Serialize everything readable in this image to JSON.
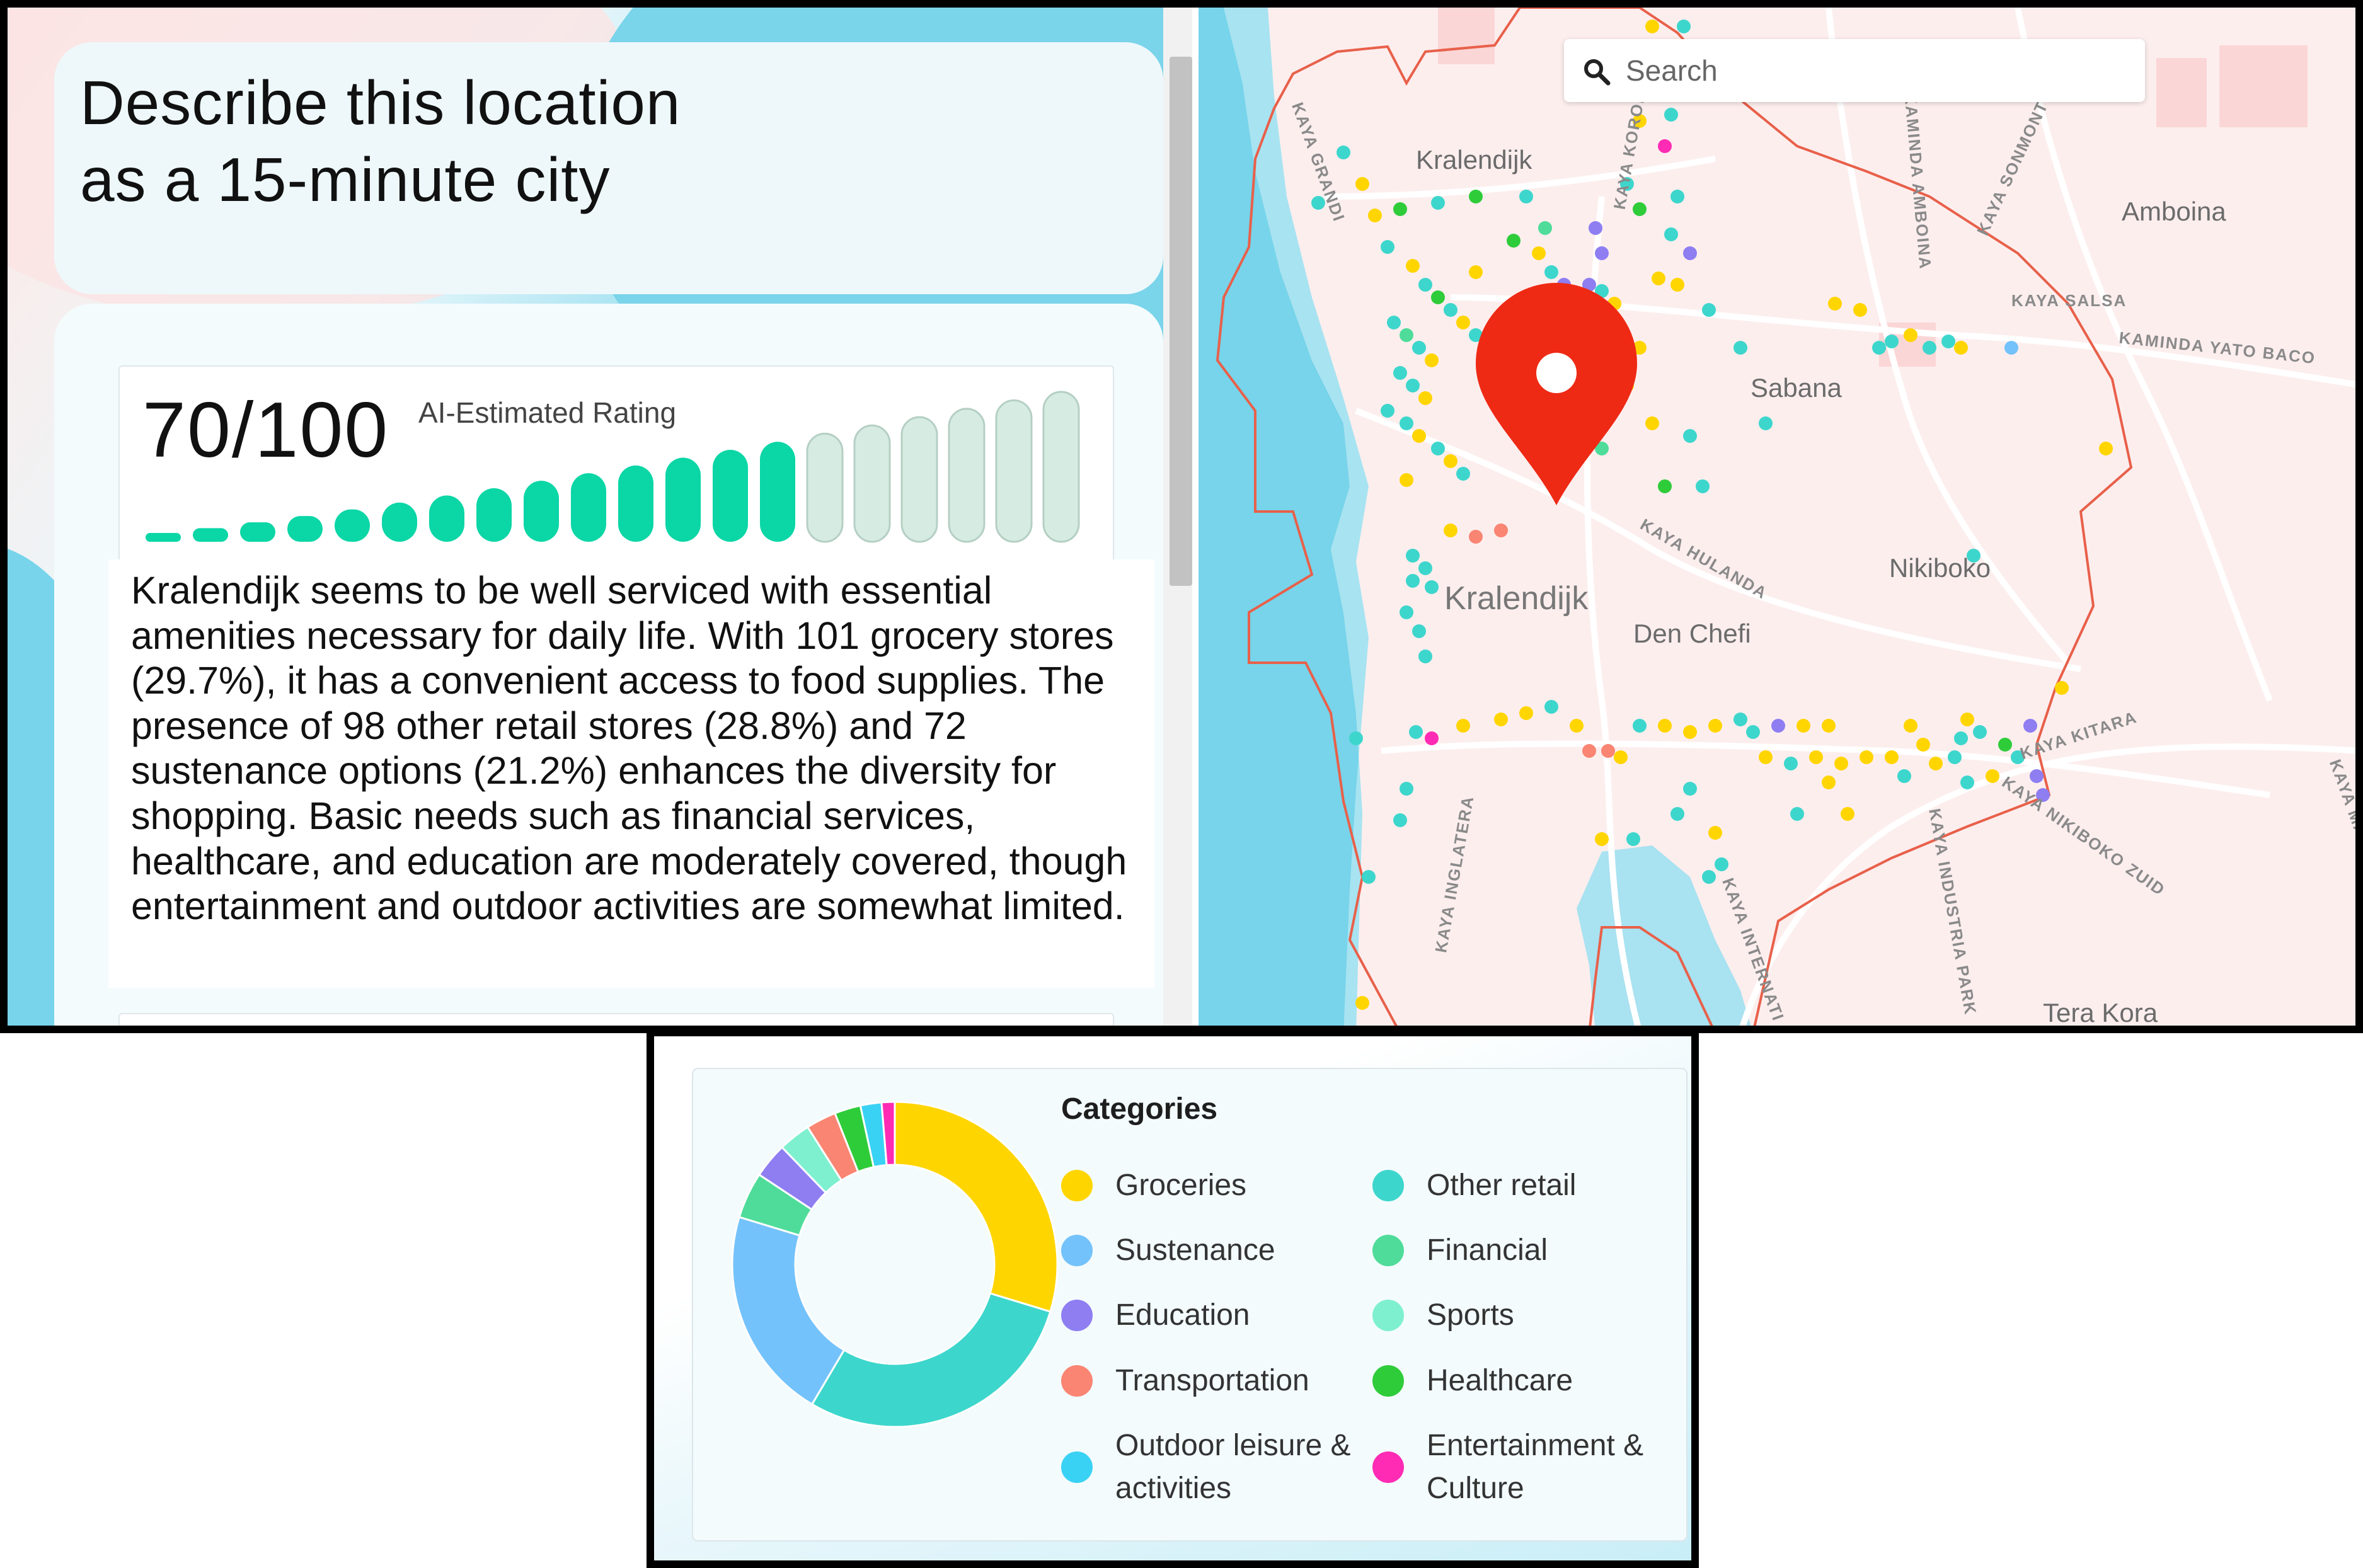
{
  "panel": {
    "title_line1": "Describe this location",
    "title_line2": "as a 15-minute city"
  },
  "rating": {
    "score_text": "70/100",
    "label": "AI-Estimated Rating",
    "score": 70,
    "max": 100,
    "filled_bars": 14,
    "total_bars": 20,
    "filled_color": "#0ad6a6",
    "empty_color": "#d6ece3"
  },
  "summary": {
    "text": "Kralendijk seems to be well serviced with essential amenities necessary for daily life. With 101 grocery stores (29.7%), it has a convenient access to food supplies. The presence of 98 other retail stores (28.8%) and 72 sustenance options (21.2%) enhances the diversity for shopping. Basic needs such as financial services, healthcare, and education are moderately covered, though entertainment and outdoor activities are somewhat limited."
  },
  "map": {
    "search_placeholder": "Search",
    "labels": {
      "kralendijk_north": "Kralendijk",
      "kralendijk_center": "Kralendijk",
      "amboina": "Amboina",
      "sabana": "Sabana",
      "nikiboko": "Nikiboko",
      "den_chefi": "Den Chefi",
      "tera_kora": "Tera Kora"
    },
    "streets": {
      "kaya_grandi": "KAYA GRANDI",
      "kaya_korona": "KAYA KORONA",
      "kaya_sonmontu": "KAYA SONMONTU",
      "kaya_salsa": "KAYA SALSA",
      "kaminda_yato_baco": "KAMINDA YATO BACO",
      "kaya_hulanda": "KAYA HULANDA",
      "kaya_kitara": "KAYA KITARA",
      "kaya_nikiboko_zuid": "KAYA NIKIBOKO ZUID",
      "kaya_inglaterra": "KAYA INGLATERA",
      "kaya_internationaal": "KAYA INTERNATI",
      "kaya_industria": "KAYA INDUSTRIA PARK",
      "kaya_amboina": "KAMINDA AMBOINA",
      "kaya_ma": "KAYA MA"
    },
    "pin_color": "#ee2a15",
    "boundary_color": "#e8604a"
  },
  "categories": {
    "heading": "Categories",
    "items": [
      {
        "label": "Groceries",
        "color": "#ffd500",
        "value": 29.7
      },
      {
        "label": "Other retail",
        "color": "#3dd6cc",
        "value": 28.8
      },
      {
        "label": "Sustenance",
        "color": "#74c2fb",
        "value": 21.2
      },
      {
        "label": "Financial",
        "color": "#4fdc9a",
        "value": 4.6
      },
      {
        "label": "Education",
        "color": "#8e7ef2",
        "value": 3.5
      },
      {
        "label": "Sports",
        "color": "#7ef0cf",
        "value": 3.2
      },
      {
        "label": "Transportation",
        "color": "#f98572",
        "value": 3.0
      },
      {
        "label": "Healthcare",
        "color": "#2fcc3a",
        "value": 2.6
      },
      {
        "label": "Outdoor leisure & activities",
        "color": "#3ad2f4",
        "value": 2.1
      },
      {
        "label": "Entertainment & Culture",
        "color": "#ff2bb4",
        "value": 1.3
      }
    ]
  }
}
